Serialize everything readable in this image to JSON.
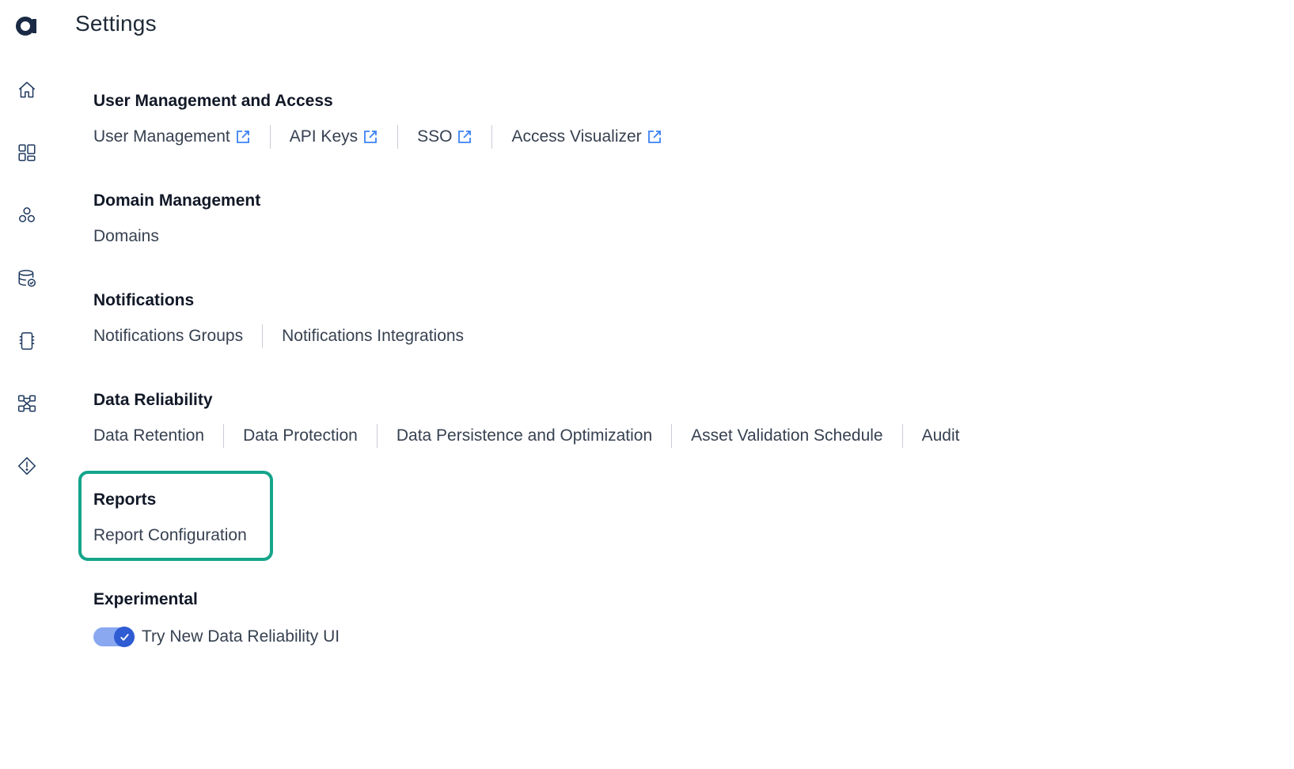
{
  "header": {
    "title": "Settings"
  },
  "sidebar": {
    "logo": "app-logo",
    "items": [
      {
        "icon": "home-icon"
      },
      {
        "icon": "dashboard-icon"
      },
      {
        "icon": "cluster-icon"
      },
      {
        "icon": "data-check-icon"
      },
      {
        "icon": "processor-icon"
      },
      {
        "icon": "pipeline-icon"
      },
      {
        "icon": "alert-diamond-icon"
      }
    ]
  },
  "sections": {
    "user_mgmt": {
      "title": "User Management and Access",
      "links": [
        "User Management",
        "API Keys",
        "SSO",
        "Access Visualizer"
      ]
    },
    "domain_mgmt": {
      "title": "Domain Management",
      "links": [
        "Domains"
      ]
    },
    "notifications": {
      "title": "Notifications",
      "links": [
        "Notifications Groups",
        "Notifications Integrations"
      ]
    },
    "data_reliability": {
      "title": "Data Reliability",
      "links": [
        "Data Retention",
        "Data Protection",
        "Data Persistence and Optimization",
        "Asset Validation Schedule",
        "Audit"
      ]
    },
    "reports": {
      "title": "Reports",
      "links": [
        "Report Configuration"
      ]
    },
    "experimental": {
      "title": "Experimental",
      "toggle_label": "Try New Data Reliability UI",
      "toggle_on": true
    }
  },
  "colors": {
    "highlight": "#14a58a",
    "toggle_track": "#8aa8f0",
    "toggle_knob": "#2f5bd3",
    "external_link": "#3b82f6",
    "icon_stroke": "#1f3a5f"
  }
}
